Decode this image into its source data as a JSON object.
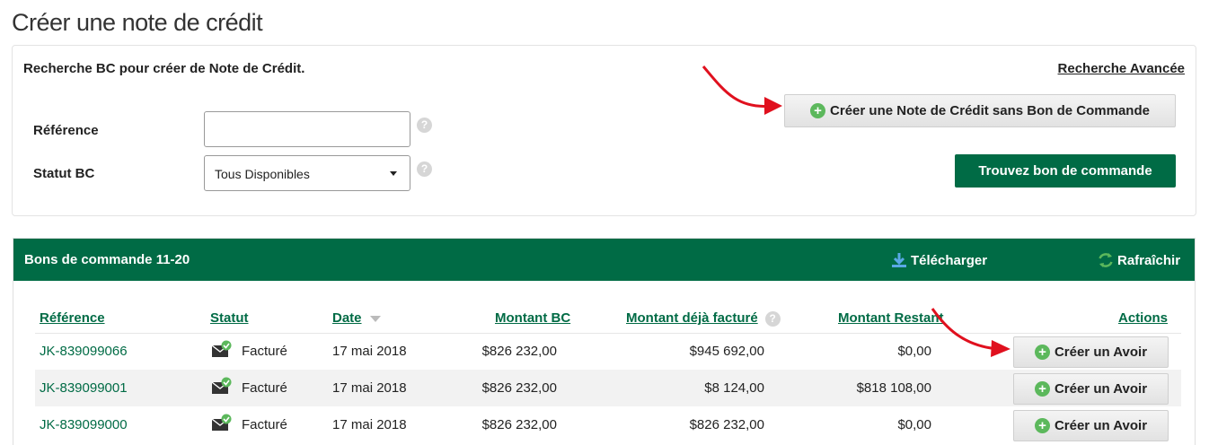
{
  "page": {
    "title": "Créer une note de crédit"
  },
  "search": {
    "heading": "Recherche BC pour créer de Note de Crédit.",
    "advanced_link": "Recherche Avancée",
    "reference_label": "Référence",
    "reference_value": "",
    "status_label": "Statut BC",
    "status_value": "Tous Disponibles",
    "help_glyph": "?",
    "create_without_po_label": "Créer une Note de Crédit sans Bon de Commande",
    "find_po_label": "Trouvez bon de commande"
  },
  "orders": {
    "title": "Bons de commande 11-20",
    "download_label": "Télécharger",
    "refresh_label": "Rafraîchir",
    "columns": {
      "reference": "Référence",
      "status": "Statut",
      "date": "Date",
      "po_amount": "Montant BC",
      "invoiced_amount": "Montant déjà facturé",
      "remaining_amount": "Montant Restant",
      "actions": "Actions"
    },
    "rows": [
      {
        "reference": "JK-839099066",
        "status": "Facturé",
        "date": "17 mai 2018",
        "po_amount": "$826 232,00",
        "invoiced": "$945 692,00",
        "remaining": "$0,00",
        "action": "Créer un Avoir"
      },
      {
        "reference": "JK-839099001",
        "status": "Facturé",
        "date": "17 mai 2018",
        "po_amount": "$826 232,00",
        "invoiced": "$8 124,00",
        "remaining": "$818 108,00",
        "action": "Créer un Avoir"
      },
      {
        "reference": "JK-839099000",
        "status": "Facturé",
        "date": "17 mai 2018",
        "po_amount": "$826 232,00",
        "invoiced": "$826 232,00",
        "remaining": "$0,00",
        "action": "Créer un Avoir"
      }
    ]
  },
  "icons": {
    "plus": "plus-circle-icon",
    "help": "question-mark-icon",
    "download": "download-icon",
    "refresh": "refresh-icon",
    "status": "invoiced-envelope-icon",
    "sort": "sort-desc-icon",
    "annotation": "red-arrow-icon"
  },
  "colors": {
    "brand_green": "#006b45",
    "plus_green": "#5cb85c",
    "arrow_red": "#e0101e"
  }
}
